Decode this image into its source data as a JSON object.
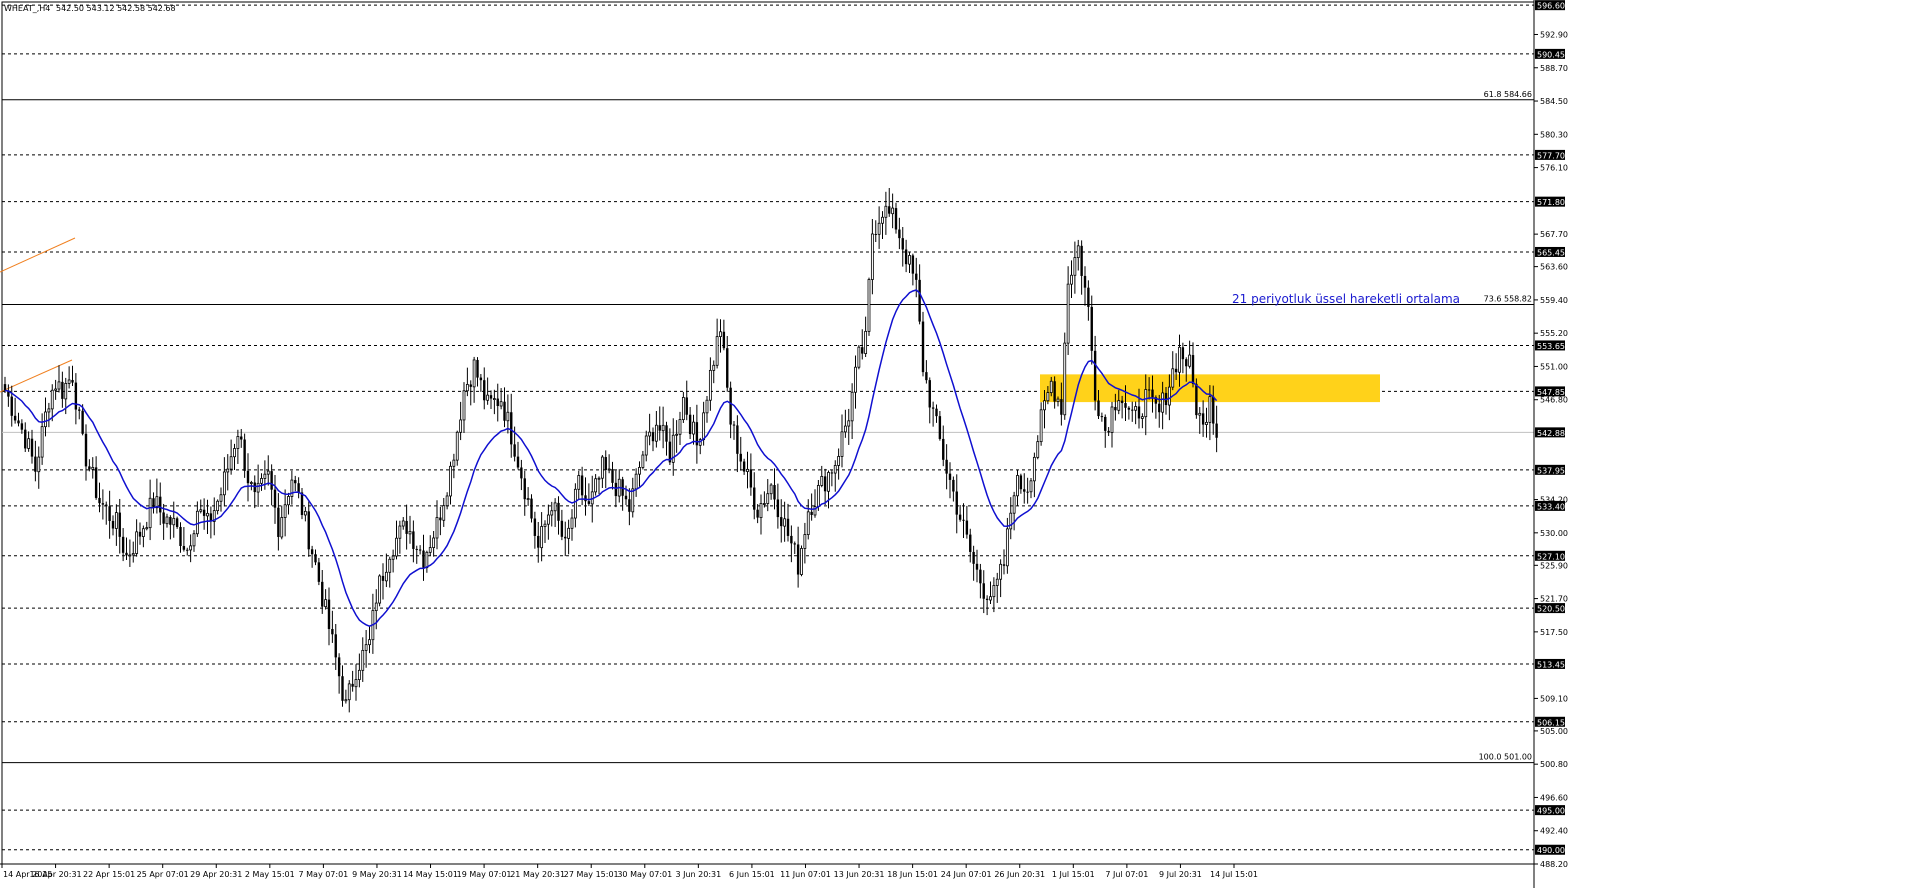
{
  "header": {
    "symbol_text": "WHEAT_,H4",
    "ohlc_text": "542.50 543.12 542.58 542.68"
  },
  "colors": {
    "background": "#ffffff",
    "candle": "#000000",
    "ema": "#1010d0",
    "zone": "#ffd21a",
    "annotation": "#1a1ad0",
    "channel": "#f08020",
    "label_box": "#000000",
    "label_text": "#ffffff"
  },
  "chart_data": {
    "type": "candlestick",
    "symbol": "WHEAT_",
    "timeframe": "H4",
    "ylim": [
      488.2,
      597.0
    ],
    "y_ticks": [
      592.9,
      588.7,
      584.5,
      580.3,
      576.1,
      567.7,
      563.6,
      559.4,
      555.2,
      551.0,
      546.8,
      534.2,
      530.0,
      525.9,
      521.7,
      517.5,
      509.1,
      505.0,
      500.8,
      496.6,
      492.4,
      488.2
    ],
    "x_tick_labels": [
      "14 Apr 2025",
      "16 Apr 20:31",
      "22 Apr 15:01",
      "25 Apr 07:01",
      "29 Apr 20:31",
      "2 May 15:01",
      "7 May 07:01",
      "9 May 20:31",
      "14 May 15:01",
      "19 May 07:01",
      "21 May 20:31",
      "27 May 15:01",
      "30 May 07:01",
      "3 Jun 20:31",
      "6 Jun 15:01",
      "11 Jun 07:01",
      "13 Jun 20:31",
      "18 Jun 15:01",
      "24 Jun 07:01",
      "26 Jun 20:31",
      "1 Jul 15:01",
      "7 Jul 07:01",
      "9 Jul 20:31",
      "14 Jul 15:01"
    ],
    "horizontal_levels": [
      {
        "price": 596.6,
        "label": "596.60"
      },
      {
        "price": 590.45,
        "label": "590.45"
      },
      {
        "price": 577.7,
        "label": "577.70"
      },
      {
        "price": 571.8,
        "label": "571.80"
      },
      {
        "price": 565.45,
        "label": "565.45"
      },
      {
        "price": 553.65,
        "label": "553.65"
      },
      {
        "price": 547.85,
        "label": "547.85"
      },
      {
        "price": 537.95,
        "label": "537.95"
      },
      {
        "price": 533.4,
        "label": "533.40"
      },
      {
        "price": 527.1,
        "label": "527.10"
      },
      {
        "price": 520.5,
        "label": "520.50"
      },
      {
        "price": 513.45,
        "label": "513.45"
      },
      {
        "price": 506.15,
        "label": "506.15"
      },
      {
        "price": 495.0,
        "label": "495.00"
      },
      {
        "price": 490.0,
        "label": "490.00"
      }
    ],
    "current_price": {
      "price": 542.68,
      "label": "542.88"
    },
    "fibonacci_levels": [
      {
        "price": 584.66,
        "label": "61.8 584.66"
      },
      {
        "price": 558.82,
        "label": "73.6 558.82"
      },
      {
        "price": 501.0,
        "label": "100.0 501.00"
      }
    ],
    "annotation": "21 periyotluk üssel hareketli ortalama",
    "ema_period": 21,
    "zone": {
      "price_high": 550.0,
      "price_low": 546.5,
      "from": "30 Jun",
      "to": "15 Jul"
    },
    "anchors": [
      [
        0,
        548
      ],
      [
        6,
        542
      ],
      [
        9,
        538
      ],
      [
        13,
        547
      ],
      [
        15,
        549
      ],
      [
        17,
        548
      ],
      [
        20,
        550
      ],
      [
        23,
        541
      ],
      [
        28,
        534
      ],
      [
        33,
        531
      ],
      [
        36,
        527
      ],
      [
        40,
        530
      ],
      [
        44,
        534
      ],
      [
        47,
        532
      ],
      [
        50,
        531
      ],
      [
        54,
        528
      ],
      [
        57,
        533
      ],
      [
        60,
        531
      ],
      [
        64,
        535
      ],
      [
        69,
        543
      ],
      [
        72,
        537
      ],
      [
        74,
        534
      ],
      [
        78,
        537
      ],
      [
        81,
        531
      ],
      [
        85,
        537
      ],
      [
        88,
        533
      ],
      [
        92,
        526
      ],
      [
        96,
        518
      ],
      [
        101,
        508
      ],
      [
        104,
        513
      ],
      [
        108,
        516
      ],
      [
        110,
        522
      ],
      [
        114,
        528
      ],
      [
        119,
        531
      ],
      [
        124,
        527
      ],
      [
        128,
        531
      ],
      [
        132,
        538
      ],
      [
        136,
        548
      ],
      [
        139,
        551
      ],
      [
        143,
        546
      ],
      [
        147,
        547
      ],
      [
        151,
        541
      ],
      [
        155,
        534
      ],
      [
        158,
        528
      ],
      [
        162,
        534
      ],
      [
        166,
        528
      ],
      [
        170,
        536
      ],
      [
        173,
        533
      ],
      [
        177,
        538
      ],
      [
        181,
        536
      ],
      [
        185,
        533
      ],
      [
        189,
        540
      ],
      [
        193,
        544
      ],
      [
        197,
        540
      ],
      [
        201,
        547
      ],
      [
        205,
        541
      ],
      [
        209,
        550
      ],
      [
        212,
        556
      ],
      [
        215,
        544
      ],
      [
        219,
        538
      ],
      [
        223,
        533
      ],
      [
        227,
        536
      ],
      [
        231,
        531
      ],
      [
        235,
        526
      ],
      [
        238,
        533
      ],
      [
        242,
        536
      ],
      [
        246,
        539
      ],
      [
        250,
        545
      ],
      [
        253,
        552
      ],
      [
        255,
        554
      ],
      [
        257,
        568
      ],
      [
        260,
        571
      ],
      [
        264,
        569
      ],
      [
        267,
        565
      ],
      [
        270,
        561
      ],
      [
        272,
        551
      ],
      [
        275,
        545
      ],
      [
        279,
        538
      ],
      [
        283,
        532
      ],
      [
        287,
        526
      ],
      [
        290,
        523
      ],
      [
        293,
        522
      ],
      [
        296,
        526
      ],
      [
        299,
        536
      ],
      [
        303,
        536
      ],
      [
        307,
        544
      ],
      [
        310,
        549
      ],
      [
        313,
        546
      ],
      [
        315,
        562
      ],
      [
        318,
        566
      ],
      [
        321,
        558
      ],
      [
        323,
        548
      ],
      [
        326,
        543
      ],
      [
        330,
        548
      ],
      [
        334,
        544
      ],
      [
        338,
        547
      ],
      [
        342,
        545
      ],
      [
        345,
        549
      ],
      [
        348,
        553
      ],
      [
        351,
        551
      ],
      [
        353,
        546
      ],
      [
        355,
        543
      ],
      [
        357,
        548
      ],
      [
        359,
        542
      ]
    ]
  }
}
